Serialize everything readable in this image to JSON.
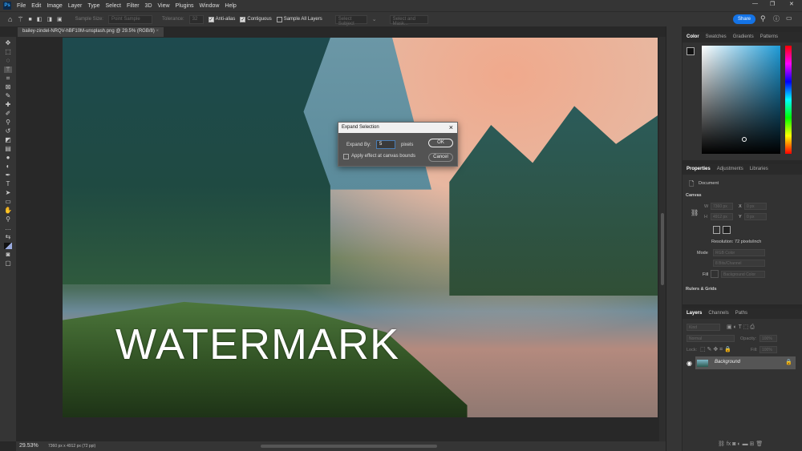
{
  "menu": {
    "items": [
      "File",
      "Edit",
      "Image",
      "Layer",
      "Type",
      "Select",
      "Filter",
      "3D",
      "View",
      "Plugins",
      "Window",
      "Help"
    ]
  },
  "options": {
    "sample_size_label": "Sample Size:",
    "sample_size_value": "Point Sample",
    "tolerance_label": "Tolerance:",
    "tolerance_value": "32",
    "anti_alias": "Anti-alias",
    "contiguous": "Contiguous",
    "sample_all_layers": "Sample All Layers",
    "select_subject": "Select Subject",
    "select_and_mask": "Select and Mask...",
    "share": "Share"
  },
  "document": {
    "tab_title": "bailey-zindel-NRQV-hBF10M-unsplash.png @ 29.5% (RGB/8)",
    "watermark_text": "WATERMARK"
  },
  "dialog": {
    "title": "Expand Selection",
    "expand_by_label": "Expand By:",
    "expand_by_value": "5",
    "unit": "pixels",
    "checkbox_label": "Apply effect at canvas bounds",
    "checkbox_checked": false,
    "ok": "OK",
    "cancel": "Cancel"
  },
  "status": {
    "zoom": "29.53%",
    "doc_size": "7360 px x 4912 px (72 ppi)"
  },
  "color_panel": {
    "tabs": [
      "Color",
      "Swatches",
      "Gradients",
      "Patterns"
    ],
    "active": "Color"
  },
  "properties_panel": {
    "tabs": [
      "Properties",
      "Adjustments",
      "Libraries"
    ],
    "active": "Properties",
    "document_label": "Document",
    "canvas_section": "Canvas",
    "w_label": "W",
    "w_value": "7360 px",
    "h_label": "H",
    "h_value": "4912 px",
    "x_label": "X",
    "x_value": "0 px",
    "y_label": "Y",
    "y_value": "0 px",
    "resolution": "Resolution: 72 pixels/inch",
    "mode_label": "Mode",
    "mode_value": "RGB Color",
    "depth_value": "8 Bits/Channel",
    "fill_label": "Fill",
    "fill_value": "Background Color",
    "rulers_section": "Rulers & Grids"
  },
  "layers_panel": {
    "tabs": [
      "Layers",
      "Channels",
      "Paths"
    ],
    "active": "Layers",
    "filter_placeholder": "Kind",
    "blend_mode": "Normal",
    "opacity_label": "Opacity:",
    "opacity_value": "100%",
    "lock_label": "Lock:",
    "fill_label": "Fill:",
    "fill_value": "100%",
    "layers": [
      {
        "name": "Background",
        "visible": true,
        "locked": true
      }
    ]
  }
}
